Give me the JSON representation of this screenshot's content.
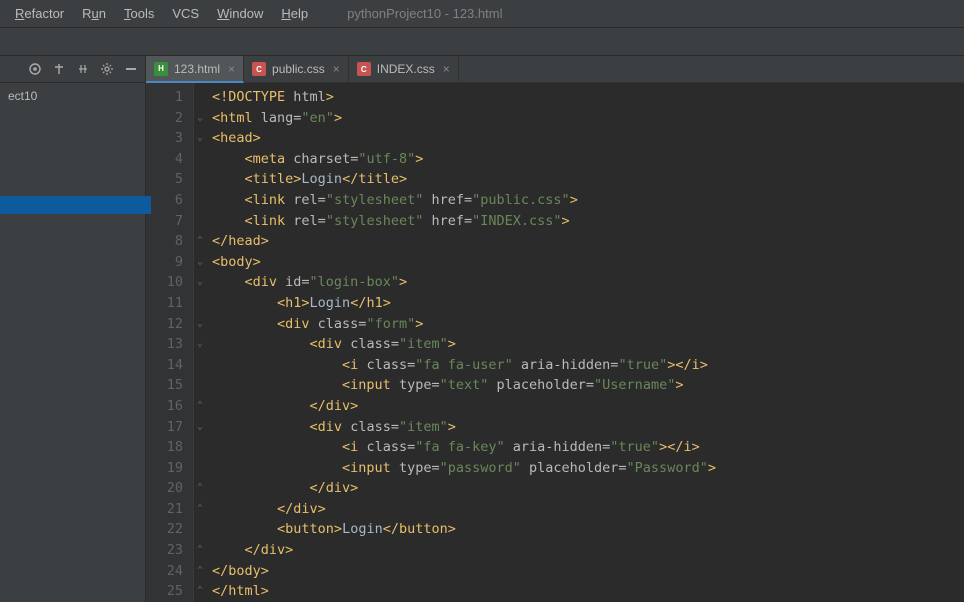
{
  "menubar": {
    "items": [
      {
        "label": "Refactor",
        "accel_index": 0
      },
      {
        "label": "Run",
        "accel_index": 1
      },
      {
        "label": "Tools",
        "accel_index": 0
      },
      {
        "label": "VCS",
        "accel_index": null
      },
      {
        "label": "Window",
        "accel_index": 0
      },
      {
        "label": "Help",
        "accel_index": 0
      }
    ],
    "project_title": "pythonProject10 - 123.html"
  },
  "sidebar": {
    "toolbar_icons": [
      "target-icon",
      "expand-icon",
      "collapse-icon",
      "gear-icon",
      "minimize-icon"
    ],
    "tree": {
      "items": [
        "ect10"
      ],
      "selected_blank": true
    }
  },
  "tabs": [
    {
      "name": "123.html",
      "type": "html",
      "active": true
    },
    {
      "name": "public.css",
      "type": "css",
      "active": false
    },
    {
      "name": "INDEX.css",
      "type": "css",
      "active": false
    }
  ],
  "editor": {
    "line_numbers": [
      1,
      2,
      3,
      4,
      5,
      6,
      7,
      8,
      9,
      10,
      11,
      12,
      13,
      14,
      15,
      16,
      17,
      18,
      19,
      20,
      21,
      22,
      23,
      24,
      25
    ],
    "code_lines": [
      {
        "indent": 0,
        "tokens": [
          [
            "decl",
            "<!DOCTYPE "
          ],
          [
            "attr",
            "html"
          ],
          [
            "decl",
            ">"
          ]
        ]
      },
      {
        "indent": 0,
        "tokens": [
          [
            "tag",
            "<html "
          ],
          [
            "attr",
            "lang="
          ],
          [
            "str",
            "\"en\""
          ],
          [
            "tag",
            ">"
          ]
        ]
      },
      {
        "indent": 0,
        "tokens": [
          [
            "tag",
            "<head>"
          ]
        ]
      },
      {
        "indent": 1,
        "tokens": [
          [
            "tag",
            "<meta "
          ],
          [
            "attr",
            "charset="
          ],
          [
            "str",
            "\"utf-8\""
          ],
          [
            "tag",
            ">"
          ]
        ]
      },
      {
        "indent": 1,
        "tokens": [
          [
            "tag",
            "<title>"
          ],
          [
            "txt",
            "Login"
          ],
          [
            "tag",
            "</title>"
          ]
        ]
      },
      {
        "indent": 1,
        "tokens": [
          [
            "tag",
            "<link "
          ],
          [
            "attr",
            "rel="
          ],
          [
            "str",
            "\"stylesheet\""
          ],
          [
            "attr",
            " href="
          ],
          [
            "str",
            "\"public.css\""
          ],
          [
            "tag",
            ">"
          ]
        ]
      },
      {
        "indent": 1,
        "tokens": [
          [
            "tag",
            "<link "
          ],
          [
            "attr",
            "rel="
          ],
          [
            "str",
            "\"stylesheet\""
          ],
          [
            "attr",
            " href="
          ],
          [
            "str",
            "\"INDEX.css\""
          ],
          [
            "tag",
            ">"
          ]
        ]
      },
      {
        "indent": 0,
        "tokens": [
          [
            "tag",
            "</head>"
          ]
        ]
      },
      {
        "indent": 0,
        "tokens": [
          [
            "tag",
            "<body>"
          ]
        ]
      },
      {
        "indent": 1,
        "tokens": [
          [
            "tag",
            "<div "
          ],
          [
            "attr",
            "id="
          ],
          [
            "str",
            "\"login-box\""
          ],
          [
            "tag",
            ">"
          ]
        ]
      },
      {
        "indent": 2,
        "tokens": [
          [
            "tag",
            "<h1>"
          ],
          [
            "txt",
            "Login"
          ],
          [
            "tag",
            "</h1>"
          ]
        ]
      },
      {
        "indent": 2,
        "tokens": [
          [
            "tag",
            "<div "
          ],
          [
            "attr",
            "class="
          ],
          [
            "str",
            "\"form\""
          ],
          [
            "tag",
            ">"
          ]
        ]
      },
      {
        "indent": 3,
        "tokens": [
          [
            "tag",
            "<div "
          ],
          [
            "attr",
            "class="
          ],
          [
            "str",
            "\"item\""
          ],
          [
            "tag",
            ">"
          ]
        ]
      },
      {
        "indent": 4,
        "tokens": [
          [
            "tag",
            "<i "
          ],
          [
            "attr",
            "class="
          ],
          [
            "str",
            "\"fa fa-user\""
          ],
          [
            "attr",
            " aria-hidden="
          ],
          [
            "str",
            "\"true\""
          ],
          [
            "tag",
            "></i>"
          ]
        ]
      },
      {
        "indent": 4,
        "tokens": [
          [
            "tag",
            "<input "
          ],
          [
            "attr",
            "type="
          ],
          [
            "str",
            "\"text\""
          ],
          [
            "attr",
            " placeholder="
          ],
          [
            "str",
            "\"Username\""
          ],
          [
            "tag",
            ">"
          ]
        ]
      },
      {
        "indent": 3,
        "tokens": [
          [
            "tag",
            "</div>"
          ]
        ]
      },
      {
        "indent": 3,
        "tokens": [
          [
            "tag",
            "<div "
          ],
          [
            "attr",
            "class="
          ],
          [
            "str",
            "\"item\""
          ],
          [
            "tag",
            ">"
          ]
        ]
      },
      {
        "indent": 4,
        "tokens": [
          [
            "tag",
            "<i "
          ],
          [
            "attr",
            "class="
          ],
          [
            "str",
            "\"fa fa-key\""
          ],
          [
            "attr",
            " aria-hidden="
          ],
          [
            "str",
            "\"true\""
          ],
          [
            "tag",
            "></i>"
          ]
        ]
      },
      {
        "indent": 4,
        "tokens": [
          [
            "tag",
            "<input "
          ],
          [
            "attr",
            "type="
          ],
          [
            "str",
            "\"password\""
          ],
          [
            "attr",
            " placeholder="
          ],
          [
            "str",
            "\"Password\""
          ],
          [
            "tag",
            ">"
          ]
        ]
      },
      {
        "indent": 3,
        "tokens": [
          [
            "tag",
            "</div>"
          ]
        ]
      },
      {
        "indent": 2,
        "tokens": [
          [
            "tag",
            "</div>"
          ]
        ]
      },
      {
        "indent": 2,
        "tokens": [
          [
            "tag",
            "<button>"
          ],
          [
            "txt",
            "Login"
          ],
          [
            "tag",
            "</button>"
          ]
        ]
      },
      {
        "indent": 1,
        "tokens": [
          [
            "tag",
            "</div>"
          ]
        ]
      },
      {
        "indent": 0,
        "tokens": [
          [
            "tag",
            "</body>"
          ]
        ]
      },
      {
        "indent": 0,
        "tokens": [
          [
            "tag",
            "</html>"
          ]
        ]
      }
    ],
    "fold_marks": {
      "2": "▾",
      "3": "▾",
      "8": "▴",
      "9": "▾",
      "10": "▾",
      "12": "▾",
      "13": "▾",
      "16": "▴",
      "17": "▾",
      "20": "▴",
      "21": "▴",
      "23": "▴",
      "24": "▴",
      "25": "▴"
    }
  }
}
